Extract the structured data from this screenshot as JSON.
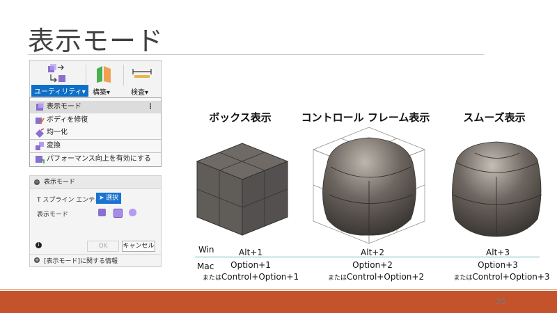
{
  "slide": {
    "title": "表示モード",
    "page_number": "35"
  },
  "ribbon": {
    "utility_label": "ユーティリティ▾",
    "construct_label": "構築▾",
    "inspect_label": "検査▾"
  },
  "menu": {
    "items": [
      {
        "label": "表示モード"
      },
      {
        "label": "ボディを修復"
      },
      {
        "label": "均一化"
      },
      {
        "label": "変換"
      },
      {
        "label": "パフォーマンス向上を有効にする"
      }
    ],
    "more": "⋮"
  },
  "dialog": {
    "title": "表示モード",
    "tspline_label": "T スプライン エンティティ",
    "select_label": "選択",
    "mode_label": "表示モード",
    "ok_label": "OK",
    "cancel_label": "キャンセル",
    "info_label": "[表示モード]に関する情報"
  },
  "modes": [
    {
      "heading": "ボックス表示",
      "win": "Alt+1",
      "mac": "Option+1",
      "mac_alt_prefix": "または",
      "mac_alt": "Control+Option+1"
    },
    {
      "heading": "コントロール フレーム表示",
      "win": "Alt+2",
      "mac": "Option+2",
      "mac_alt_prefix": "または",
      "mac_alt": "Control+Option+2"
    },
    {
      "heading": "スムーズ表示",
      "win": "Alt+3",
      "mac": "Option+3",
      "mac_alt_prefix": "または",
      "mac_alt": "Control+Option+3"
    }
  ],
  "row_labels": {
    "win": "Win",
    "mac": "Mac"
  },
  "colors": {
    "accent_blue": "#0e6fc7",
    "footer": "#c4522a",
    "divider_teal": "#5fb3b3"
  }
}
